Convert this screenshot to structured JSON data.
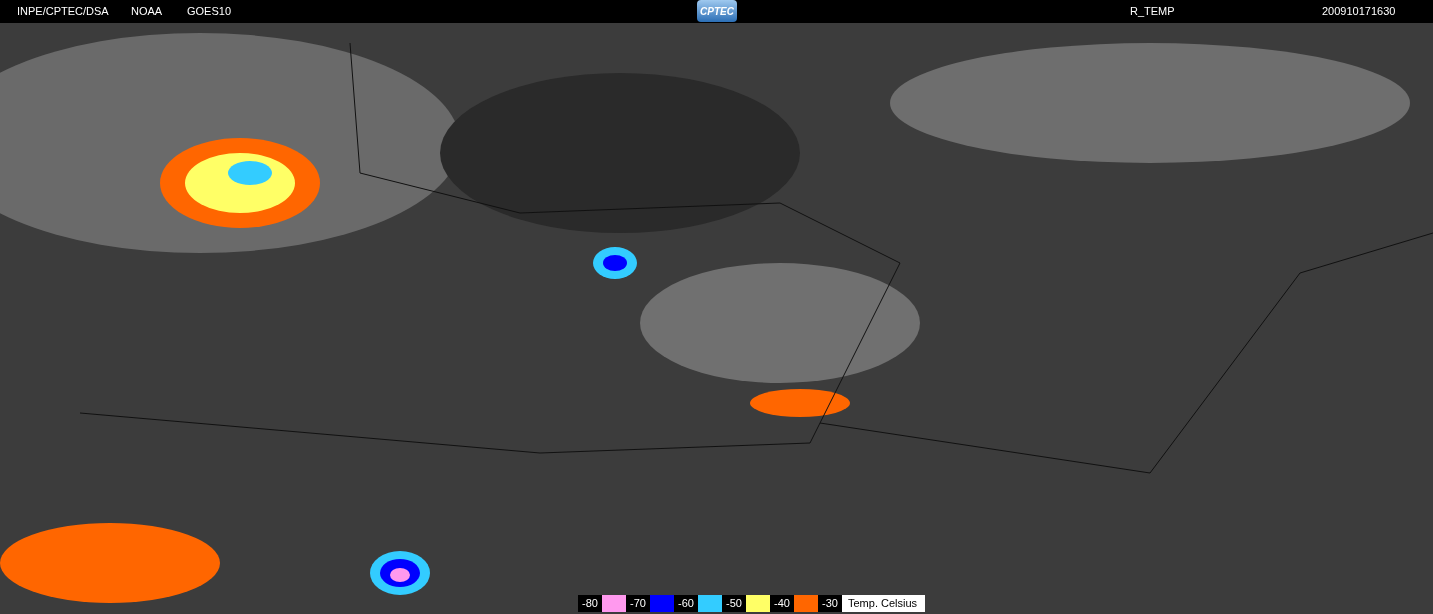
{
  "header": {
    "left_labels": [
      "INPE/CPTEC/DSA",
      "NOAA",
      "GOES10"
    ],
    "logo": "CPTEC",
    "product": "R_TEMP",
    "timestamp": "200910171630"
  },
  "legend": {
    "ticks": [
      "-80",
      "-70",
      "-60",
      "-50",
      "-40",
      "-30"
    ],
    "bands": [
      {
        "color": "#ff99ee"
      },
      {
        "color": "#0000ff"
      },
      {
        "color": "#33ccff"
      },
      {
        "color": "#ffff66"
      },
      {
        "color": "#ff6600"
      }
    ],
    "unit": "Temp. Celsius"
  }
}
